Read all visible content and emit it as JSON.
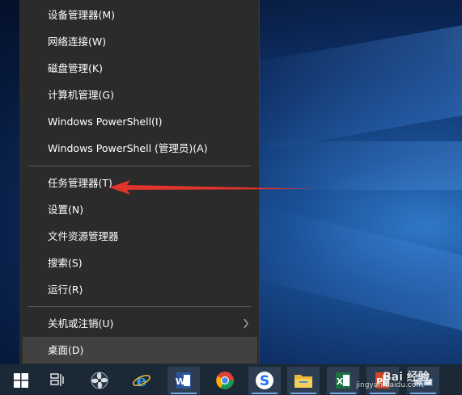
{
  "menu": {
    "items": [
      {
        "label": "设备管理器(M)"
      },
      {
        "label": "网络连接(W)"
      },
      {
        "label": "磁盘管理(K)"
      },
      {
        "label": "计算机管理(G)"
      },
      {
        "label": "Windows PowerShell(I)"
      },
      {
        "label": "Windows PowerShell (管理员)(A)"
      },
      {
        "label": "任务管理器(T)"
      },
      {
        "label": "设置(N)"
      },
      {
        "label": "文件资源管理器"
      },
      {
        "label": "搜索(S)"
      },
      {
        "label": "运行(R)"
      },
      {
        "label": "关机或注销(U)"
      },
      {
        "label": "桌面(D)"
      }
    ]
  },
  "annotation": {
    "color": "#e0342c"
  },
  "taskbar": {
    "icons": [
      "windows-start-icon",
      "task-view-icon",
      "fan-app-icon",
      "ie-browser-icon",
      "word-icon",
      "chrome-icon",
      "sogou-icon",
      "file-explorer-icon",
      "excel-icon",
      "powerpoint-icon",
      "network-icon"
    ]
  },
  "watermark": {
    "brand": "Bai 经验",
    "url": "jingyan.baidu.com"
  }
}
